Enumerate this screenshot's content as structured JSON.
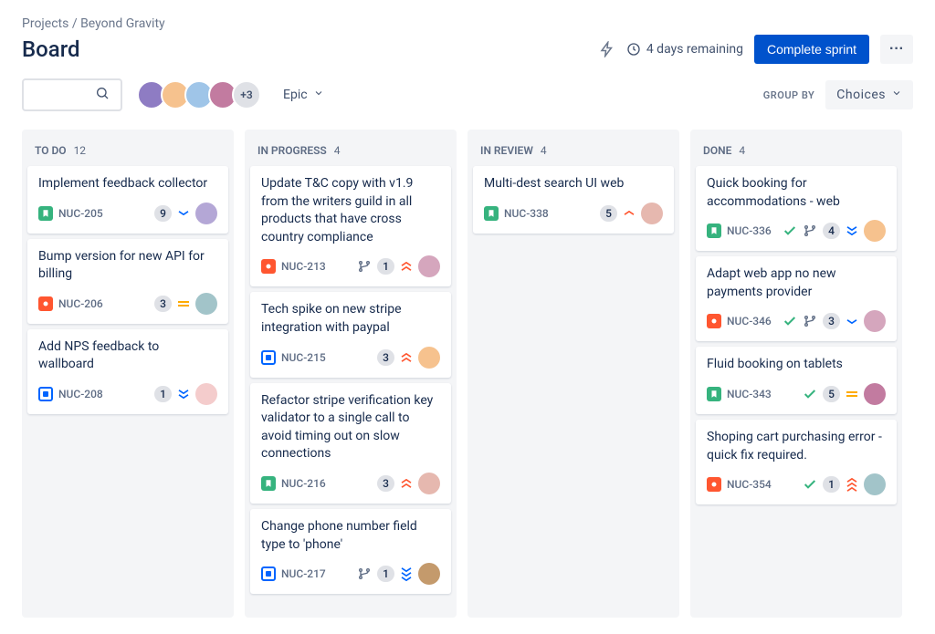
{
  "breadcrumb": {
    "parent": "Projects",
    "child": "Beyond Gravity"
  },
  "page_title": "Board",
  "header": {
    "remaining_label": "4 days remaining",
    "complete_label": "Complete sprint"
  },
  "filters": {
    "avatar_overflow": "+3",
    "epic_label": "Epic",
    "group_by_label": "GROUP BY",
    "group_by_value": "Choices"
  },
  "avatar_colors": [
    "#8e7cc3",
    "#f6c28e",
    "#9fc5e8",
    "#c27ba0"
  ],
  "columns": [
    {
      "title": "TO DO",
      "count": "12",
      "cards": [
        {
          "title": "Implement feedback collector",
          "type": "story",
          "key": "NUC-205",
          "check": false,
          "branch": false,
          "badge": "9",
          "priority": "down-blue",
          "avatar": "#b4a7d6"
        },
        {
          "title": "Bump version for new API for billing",
          "type": "bug",
          "key": "NUC-206",
          "check": false,
          "branch": false,
          "badge": "3",
          "priority": "equal-yellow",
          "avatar": "#a2c4c9"
        },
        {
          "title": "Add NPS feedback to wallboard",
          "type": "task",
          "key": "NUC-208",
          "check": false,
          "branch": false,
          "badge": "1",
          "priority": "down2-blue",
          "avatar": "#f4cccc"
        }
      ]
    },
    {
      "title": "IN PROGRESS",
      "count": "4",
      "cards": [
        {
          "title": "Update T&C copy with v1.9 from the writers guild in all products that have cross country compliance",
          "type": "bug",
          "key": "NUC-213",
          "check": false,
          "branch": true,
          "badge": "1",
          "priority": "up2-red",
          "avatar": "#d5a6bd"
        },
        {
          "title": "Tech spike on new stripe integration with paypal",
          "type": "task",
          "key": "NUC-215",
          "check": false,
          "branch": false,
          "badge": "3",
          "priority": "up2-red",
          "avatar": "#f6c28e"
        },
        {
          "title": "Refactor stripe verification key validator to a single call to avoid timing out on slow connections",
          "type": "story",
          "key": "NUC-216",
          "check": false,
          "branch": false,
          "badge": "3",
          "priority": "up2-red",
          "avatar": "#e6b8af"
        },
        {
          "title": "Change phone number field type to 'phone'",
          "type": "task",
          "key": "NUC-217",
          "check": false,
          "branch": true,
          "badge": "1",
          "priority": "down3-blue",
          "avatar": "#c49a6c"
        }
      ]
    },
    {
      "title": "IN REVIEW",
      "count": "4",
      "cards": [
        {
          "title": "Multi-dest search UI web",
          "type": "story",
          "key": "NUC-338",
          "check": false,
          "branch": false,
          "badge": "5",
          "priority": "up-red",
          "avatar": "#e6b8af"
        }
      ]
    },
    {
      "title": "DONE",
      "count": "4",
      "cards": [
        {
          "title": "Quick booking for accommodations - web",
          "type": "story",
          "key": "NUC-336",
          "check": true,
          "branch": true,
          "badge": "4",
          "priority": "down2-blue",
          "avatar": "#f6c28e"
        },
        {
          "title": "Adapt web app no new payments provider",
          "type": "bug",
          "key": "NUC-346",
          "check": true,
          "branch": true,
          "badge": "3",
          "priority": "down-blue",
          "avatar": "#d5a6bd"
        },
        {
          "title": "Fluid booking on tablets",
          "type": "story",
          "key": "NUC-343",
          "check": true,
          "branch": false,
          "badge": "5",
          "priority": "equal-yellow",
          "avatar": "#c27ba0"
        },
        {
          "title": "Shoping cart purchasing error - quick fix required.",
          "type": "bug",
          "key": "NUC-354",
          "check": true,
          "branch": false,
          "badge": "1",
          "priority": "up3-red",
          "avatar": "#a2c4c9"
        }
      ]
    }
  ]
}
